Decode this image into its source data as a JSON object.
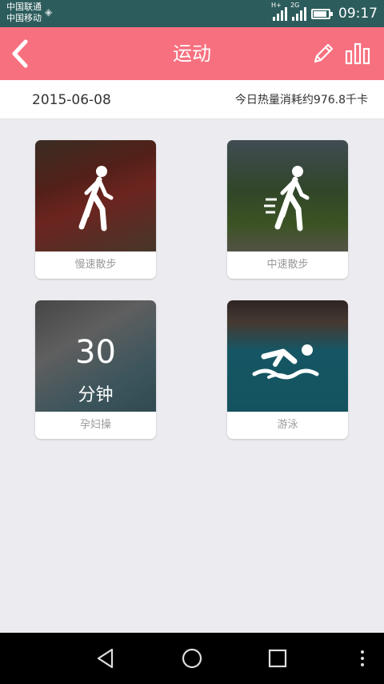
{
  "status_bar": {
    "carrier_1": "中国联通",
    "carrier_2": "中国移动",
    "network_tag_1": "H+",
    "network_tag_2": "2G",
    "time": "09:17"
  },
  "header": {
    "title": "运动",
    "background": "#f7707f"
  },
  "summary": {
    "date": "2015-06-08",
    "calories": "今日热量消耗约976.8千卡"
  },
  "activities": [
    {
      "label": "慢速散步",
      "icon": "walking-icon"
    },
    {
      "label": "中速散步",
      "icon": "brisk-walking-icon"
    },
    {
      "label": "孕妇操",
      "icon": "duration-text",
      "value": "30",
      "unit": "分钟"
    },
    {
      "label": "游泳",
      "icon": "swimming-icon"
    }
  ],
  "nav": {
    "icons": [
      "back-triangle-icon",
      "home-circle-icon",
      "recents-square-icon",
      "more-dots-icon"
    ]
  }
}
